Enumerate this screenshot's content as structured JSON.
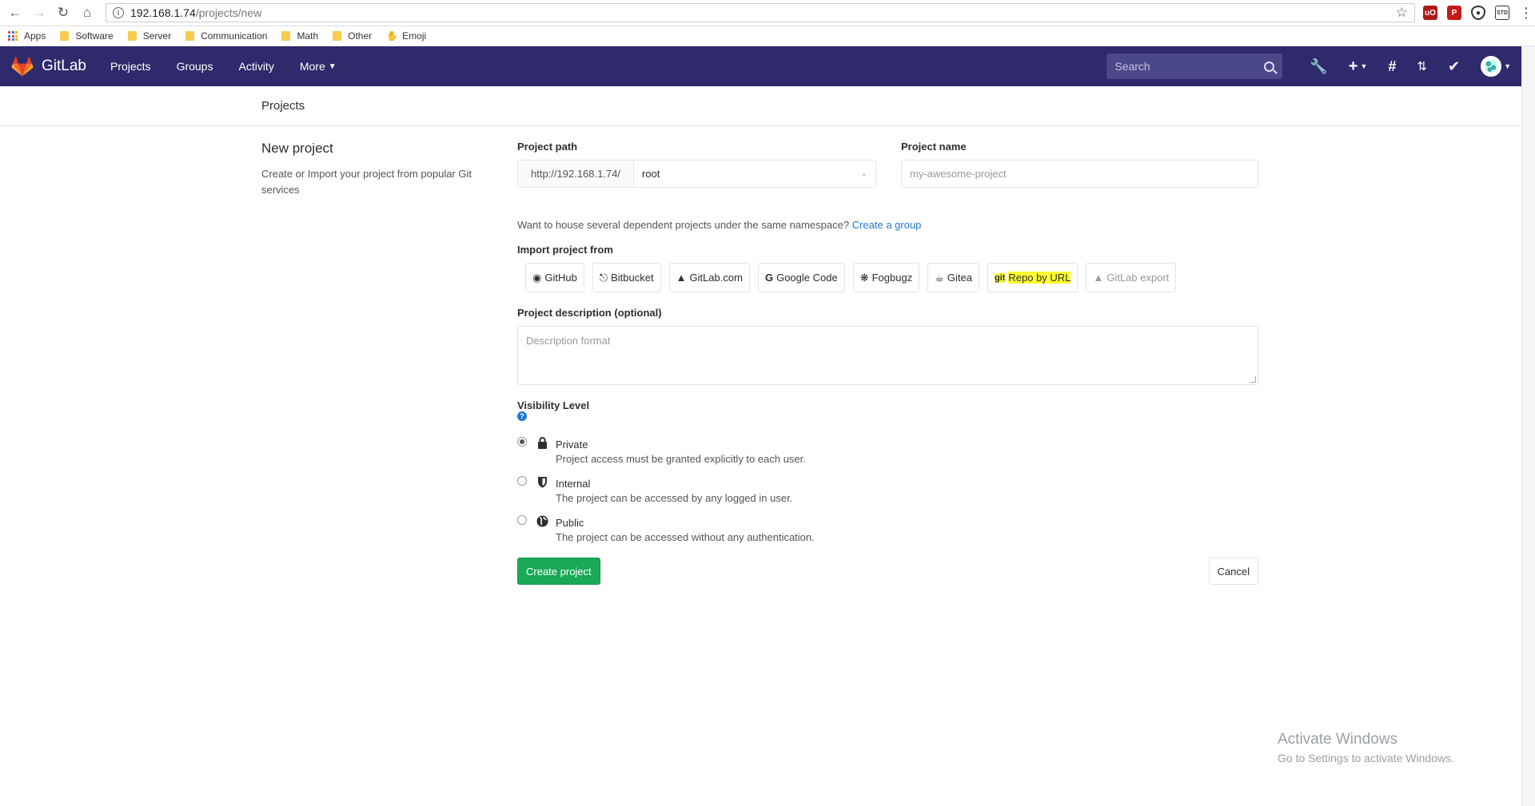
{
  "browser": {
    "url_host": "192.168.1.74",
    "url_path": "/projects/new",
    "bookmarks": [
      "Apps",
      "Software",
      "Server",
      "Communication",
      "Math",
      "Other",
      "Emoji"
    ]
  },
  "nav": {
    "brand": "GitLab",
    "links": [
      "Projects",
      "Groups",
      "Activity",
      "More"
    ],
    "search_placeholder": "Search"
  },
  "title_bar": "Projects",
  "left": {
    "heading": "New project",
    "description": "Create or Import your project from popular Git services"
  },
  "form": {
    "path_label": "Project path",
    "path_prefix": "http://192.168.1.74/",
    "namespace": "root",
    "name_label": "Project name",
    "name_placeholder": "my-awesome-project",
    "namespace_note": "Want to house several dependent projects under the same namespace?",
    "create_group_link": "Create a group",
    "import_label": "Import project from",
    "import_sources": [
      "GitHub",
      "Bitbucket",
      "GitLab.com",
      "Google Code",
      "Fogbugz",
      "Gitea",
      "Repo by URL",
      "GitLab export"
    ],
    "git_prefix": "git",
    "desc_label": "Project description (optional)",
    "desc_placeholder": "Description format",
    "visibility_label": "Visibility Level",
    "visibility": [
      {
        "title": "Private",
        "desc": "Project access must be granted explicitly to each user."
      },
      {
        "title": "Internal",
        "desc": "The project can be accessed by any logged in user."
      },
      {
        "title": "Public",
        "desc": "The project can be accessed without any authentication."
      }
    ],
    "create_button": "Create project",
    "cancel_button": "Cancel"
  },
  "watermark": {
    "line1": "Activate Windows",
    "line2": "Go to Settings to activate Windows."
  },
  "colors": {
    "nav_bg": "#2f2a6b",
    "create_green": "#1aaa55",
    "link_blue": "#1f78d1",
    "highlight": "#ffff33"
  }
}
